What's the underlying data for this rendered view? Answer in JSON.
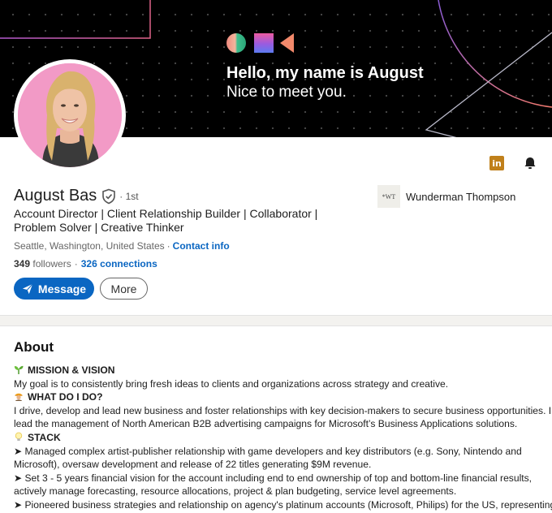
{
  "banner": {
    "greeting": "Hello, my name is August",
    "subgreeting": "Nice to meet you."
  },
  "profile": {
    "name": "August Bas",
    "degree": "· 1st",
    "headline": "Account Director | Client Relationship Builder | Collaborator | Problem Solver | Creative Thinker",
    "location": "Seattle, Washington, United States",
    "separator": "·",
    "contact_info": "Contact info",
    "followers_count": "349",
    "followers_label": "followers",
    "connections": "326 connections"
  },
  "company": {
    "logo_text": "*WT",
    "name": "Wunderman Thompson"
  },
  "actions": {
    "message": "Message",
    "more": "More"
  },
  "icons": {
    "linkedin": "linkedin-icon",
    "bell": "bell-icon",
    "verified": "verified-shield-icon",
    "send": "send-icon"
  },
  "colors": {
    "accent": "#0a66c2",
    "linkedin_badge": "#c0801b",
    "avatar_bg": "#f29ac6"
  },
  "about": {
    "title": "About",
    "lines": [
      {
        "type": "heading",
        "emoji": "seedling",
        "text": "MISSION & VISION"
      },
      {
        "type": "text",
        "text": "My goal is to consistently bring fresh ideas to clients and organizations across strategy and creative."
      },
      {
        "type": "heading",
        "emoji": "worker",
        "text": "WHAT DO I DO?"
      },
      {
        "type": "text",
        "text": "I drive, develop and lead new business and foster relationships with key decision-makers to secure business opportunities. I"
      },
      {
        "type": "text",
        "text": "lead the management of North American B2B advertising campaigns for Microsoft’s Business Applications solutions."
      },
      {
        "type": "heading",
        "emoji": "bulb",
        "text": "STACK"
      },
      {
        "type": "text",
        "text": "➤ Managed complex artist-publisher relationship with game developers and key distributors (e.g. Sony, Nintendo and"
      },
      {
        "type": "text",
        "text": "Microsoft), oversaw development and release of 22 titles generating $9M revenue."
      },
      {
        "type": "text",
        "text": "➤ Set 3 - 5 years financial vision for the account including end to end ownership of top and bottom-line financial results,"
      },
      {
        "type": "text",
        "text": "actively manage forecasting, resource allocations, project & plan budgeting, service level agreements."
      },
      {
        "type": "text",
        "text": "➤ Pioneered business strategies and relationship on agency's platinum accounts (Microsoft, Philips) for the US, representing"
      }
    ]
  }
}
